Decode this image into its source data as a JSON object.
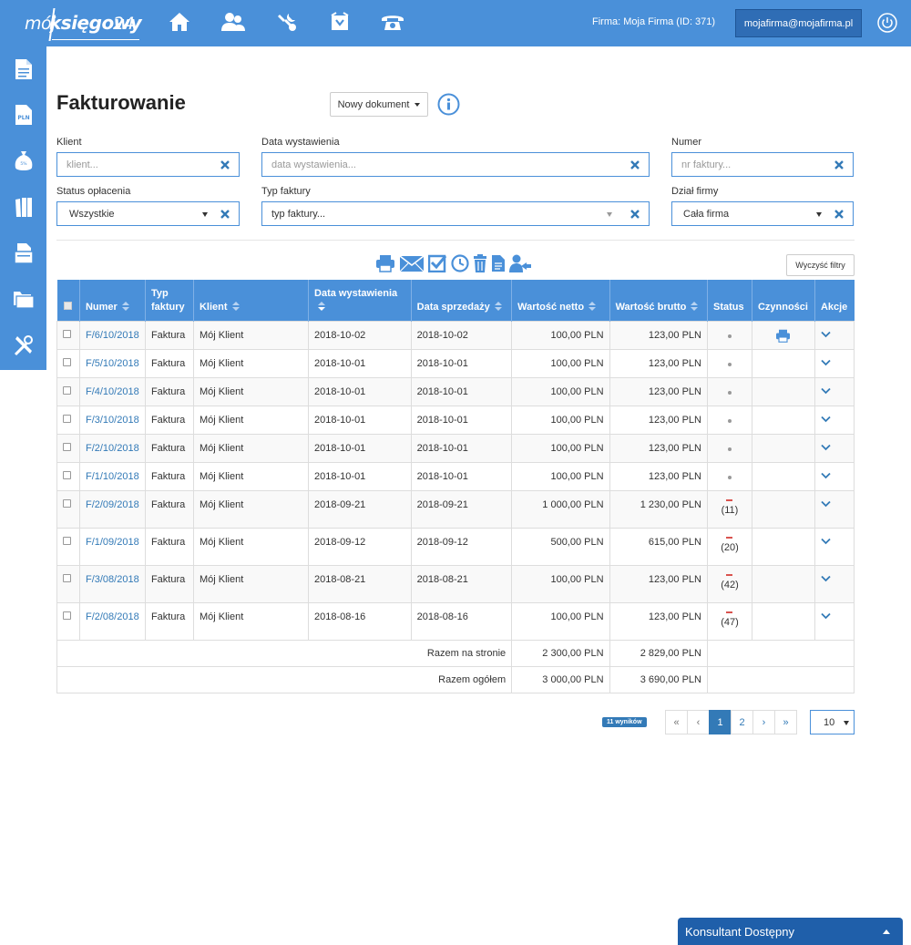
{
  "app": {
    "logo": {
      "part1": "mój",
      "part2": "księgowy",
      "part3": "24"
    },
    "firm_label": "Firma: Moja Firma (ID: 371)",
    "user_email": "mojafirma@mojafirma.pl"
  },
  "topnav": [
    "home-icon",
    "users-icon",
    "wrench-icon",
    "inbox-icon",
    "phone-icon"
  ],
  "sidebar": [
    "document-icon",
    "pln-document-icon",
    "vat-bag-icon",
    "books-icon",
    "stack-document-icon",
    "folders-icon",
    "tools-icon"
  ],
  "page": {
    "title": "Fakturowanie",
    "new_document": "Nowy dokument"
  },
  "filters": {
    "client": {
      "label": "Klient",
      "placeholder": "klient..."
    },
    "issue_date": {
      "label": "Data wystawienia",
      "placeholder": "data wystawienia..."
    },
    "number": {
      "label": "Numer",
      "placeholder": "nr faktury..."
    },
    "payment_status": {
      "label": "Status opłacenia",
      "value": "Wszystkie"
    },
    "invoice_type": {
      "label": "Typ faktury",
      "placeholder": "typ faktury..."
    },
    "department": {
      "label": "Dział firmy",
      "value": "Cała firma"
    },
    "clear_all": "Wyczyść filtry"
  },
  "toolbar": [
    "print-icon",
    "envelope-icon",
    "checkbox-icon",
    "clock-icon",
    "trash-icon",
    "file-icon",
    "user-share-icon"
  ],
  "table": {
    "headers": {
      "number": "Numer",
      "type": "Typ faktury",
      "client": "Klient",
      "issue_date": "Data wystawienia",
      "sale_date": "Data sprzedaży",
      "net": "Wartość netto",
      "gross": "Wartość brutto",
      "status": "Status",
      "activities": "Czynności",
      "actions": "Akcje"
    },
    "rows": [
      {
        "number": "F/6/10/2018",
        "type": "Faktura",
        "client": "Mój Klient",
        "issue_date": "2018-10-02",
        "sale_date": "2018-10-02",
        "net": "100,00 PLN",
        "gross": "123,00 PLN",
        "status": "",
        "print": true
      },
      {
        "number": "F/5/10/2018",
        "type": "Faktura",
        "client": "Mój Klient",
        "issue_date": "2018-10-01",
        "sale_date": "2018-10-01",
        "net": "100,00 PLN",
        "gross": "123,00 PLN",
        "status": "",
        "print": false
      },
      {
        "number": "F/4/10/2018",
        "type": "Faktura",
        "client": "Mój Klient",
        "issue_date": "2018-10-01",
        "sale_date": "2018-10-01",
        "net": "100,00 PLN",
        "gross": "123,00 PLN",
        "status": "",
        "print": false
      },
      {
        "number": "F/3/10/2018",
        "type": "Faktura",
        "client": "Mój Klient",
        "issue_date": "2018-10-01",
        "sale_date": "2018-10-01",
        "net": "100,00 PLN",
        "gross": "123,00 PLN",
        "status": "",
        "print": false
      },
      {
        "number": "F/2/10/2018",
        "type": "Faktura",
        "client": "Mój Klient",
        "issue_date": "2018-10-01",
        "sale_date": "2018-10-01",
        "net": "100,00 PLN",
        "gross": "123,00 PLN",
        "status": "",
        "print": false
      },
      {
        "number": "F/1/10/2018",
        "type": "Faktura",
        "client": "Mój Klient",
        "issue_date": "2018-10-01",
        "sale_date": "2018-10-01",
        "net": "100,00 PLN",
        "gross": "123,00 PLN",
        "status": "",
        "print": false
      },
      {
        "number": "F/2/09/2018",
        "type": "Faktura",
        "client": "Mój Klient",
        "issue_date": "2018-09-21",
        "sale_date": "2018-09-21",
        "net": "1 000,00 PLN",
        "gross": "1 230,00 PLN",
        "status": "(11)",
        "print": false
      },
      {
        "number": "F/1/09/2018",
        "type": "Faktura",
        "client": "Mój Klient",
        "issue_date": "2018-09-12",
        "sale_date": "2018-09-12",
        "net": "500,00 PLN",
        "gross": "615,00 PLN",
        "status": "(20)",
        "print": false
      },
      {
        "number": "F/3/08/2018",
        "type": "Faktura",
        "client": "Mój Klient",
        "issue_date": "2018-08-21",
        "sale_date": "2018-08-21",
        "net": "100,00 PLN",
        "gross": "123,00 PLN",
        "status": "(42)",
        "print": false
      },
      {
        "number": "F/2/08/2018",
        "type": "Faktura",
        "client": "Mój Klient",
        "issue_date": "2018-08-16",
        "sale_date": "2018-08-16",
        "net": "100,00 PLN",
        "gross": "123,00 PLN",
        "status": "(47)",
        "print": false
      }
    ],
    "totals": {
      "page_label": "Razem na stronie",
      "page_net": "2 300,00 PLN",
      "page_gross": "2 829,00 PLN",
      "all_label": "Razem ogółem",
      "all_net": "3 000,00 PLN",
      "all_gross": "3 690,00 PLN"
    }
  },
  "pagination": {
    "results": "11 wyników",
    "first": "«",
    "prev": "‹",
    "pages": [
      "1",
      "2"
    ],
    "current": "1",
    "next": "›",
    "last": "»",
    "per_page": "10"
  },
  "chat": {
    "label": "Konsultant Dostępny"
  },
  "colors": {
    "brand": "#4a90d9",
    "link": "#337ab7",
    "danger": "#d9534f"
  }
}
